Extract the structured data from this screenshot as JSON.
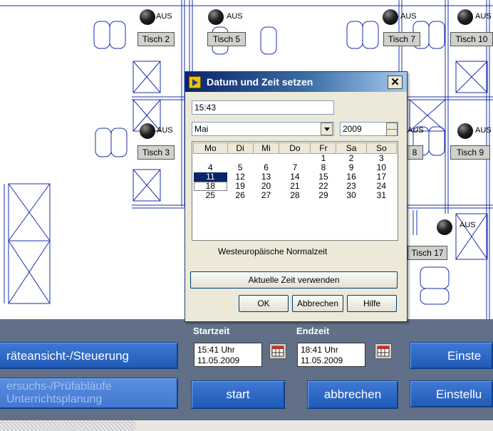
{
  "floor": {
    "tables": [
      {
        "id": "tisch-2",
        "label": "Tisch 2",
        "status": "AUS"
      },
      {
        "id": "tisch-5",
        "label": "Tisch 5",
        "status": "AUS"
      },
      {
        "id": "tisch-7",
        "label": "Tisch 7",
        "status": "AUS"
      },
      {
        "id": "tisch-10",
        "label": "Tisch 10",
        "status": "AUS"
      },
      {
        "id": "tisch-3",
        "label": "Tisch 3",
        "status": "AUS"
      },
      {
        "id": "tisch-8",
        "label": "8",
        "status": "AUS"
      },
      {
        "id": "tisch-9",
        "label": "Tisch 9",
        "status": "AUS"
      },
      {
        "id": "tisch-17",
        "label": "Tisch 17",
        "status": "AUS"
      }
    ],
    "colors": {
      "lines": "#1a2fb0",
      "panel": "#627087",
      "button": "#2b66c6"
    }
  },
  "dialog": {
    "title": "Datum und Zeit setzen",
    "close_label": "✕",
    "time_value": "15:43",
    "month": "Mai",
    "year": "2009",
    "weekdays": [
      "Mo",
      "Di",
      "Mi",
      "Do",
      "Fr",
      "Sa",
      "So"
    ],
    "weeks": [
      [
        "",
        "",
        "",
        "",
        "1",
        "2",
        "3"
      ],
      [
        "4",
        "5",
        "6",
        "7",
        "8",
        "9",
        "10"
      ],
      [
        "11",
        "12",
        "13",
        "14",
        "15",
        "16",
        "17"
      ],
      [
        "18",
        "19",
        "20",
        "21",
        "22",
        "23",
        "24"
      ],
      [
        "25",
        "26",
        "27",
        "28",
        "29",
        "30",
        "31"
      ]
    ],
    "selected_day": "11",
    "today_day": "18",
    "timezone": "Westeuropäische Normalzeit",
    "use_current_label": "Aktuelle Zeit verwenden",
    "ok_label": "OK",
    "cancel_label": "Abbrechen",
    "help_label": "Hilfe"
  },
  "panel": {
    "start_label": "Startzeit",
    "end_label": "Endzeit",
    "start_time": "15:41 Uhr",
    "start_date": "11.05.2009",
    "end_time": "18:41 Uhr",
    "end_date": "11.05.2009",
    "geraete_label": "räteansicht-/Steuerung",
    "versuchs_line1": "ersuchs-/Prüfabläufe",
    "versuchs_line2": "Unterrichtsplanung",
    "start_button": "start",
    "abbrechen_button": "abbrechen",
    "einstell_top": "Einste",
    "einstell_bottom": "Einstellu"
  }
}
